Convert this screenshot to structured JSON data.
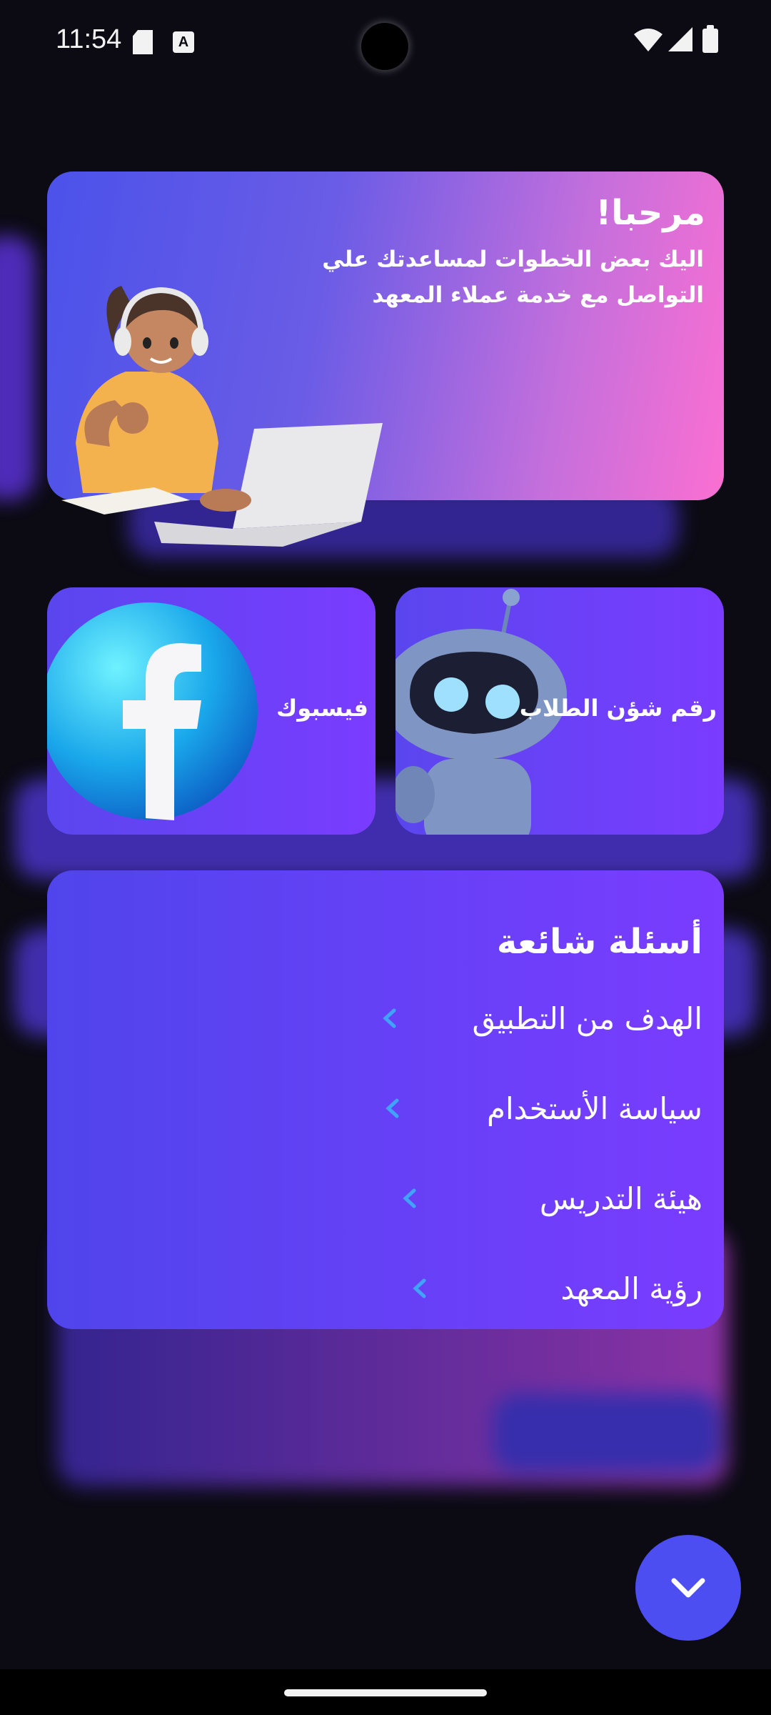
{
  "status_bar": {
    "time": "11:54",
    "a_badge": "A"
  },
  "hero": {
    "title": "مرحبا!",
    "subtitle": "اليك بعض الخطوات لمساعدتك علي التواصل مع خدمة عملاء المعهد",
    "illustration": "support-agent-laptop-illustration"
  },
  "quick_links": [
    {
      "label": "فيسبوك",
      "icon": "facebook-logo-icon"
    },
    {
      "label": "رقم شؤن الطلاب",
      "icon": "robot-icon"
    }
  ],
  "faq": {
    "title": "أسئلة شائعة",
    "items": [
      {
        "label": "الهدف من التطبيق"
      },
      {
        "label": "سياسة الأستخدام"
      },
      {
        "label": "هيئة التدريس"
      },
      {
        "label": "رؤية المعهد"
      }
    ]
  },
  "colors": {
    "background": "#0c0b14",
    "card_purple": "#7a3cff",
    "hero_pink": "#fb6fd2",
    "fab_blue": "#4d4ef2",
    "chevron_blue": "#3fa3ff"
  }
}
